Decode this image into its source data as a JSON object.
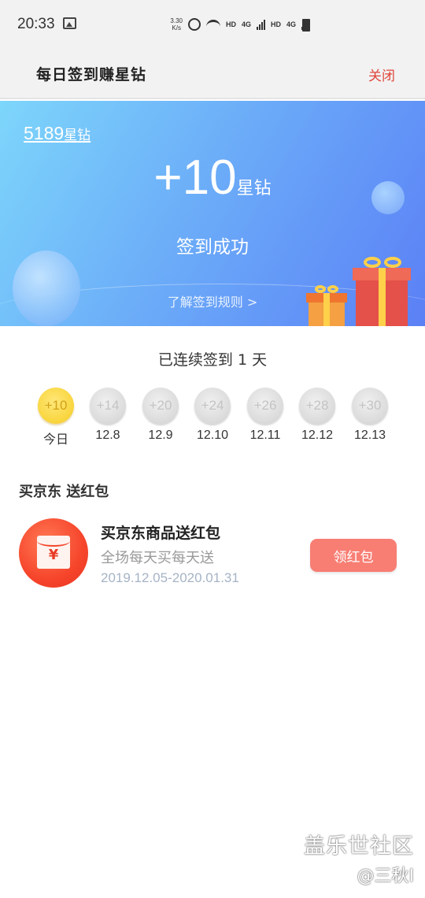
{
  "status_bar": {
    "time": "20:33",
    "net_speed_value": "3.30",
    "net_speed_unit": "K/s",
    "hd1": "HD",
    "net1": "4G",
    "hd2": "HD",
    "net2": "4G"
  },
  "header": {
    "title": "每日签到赚星钻",
    "close_label": "关闭"
  },
  "banner": {
    "balance_value": "5189",
    "balance_unit": "星钻",
    "gain_value": "+10",
    "gain_unit": "星钻",
    "status": "签到成功",
    "rules_link": "了解签到规则 >"
  },
  "streak": {
    "text": "已连续签到 1 天",
    "days": [
      {
        "reward": "+10",
        "label": "今日",
        "claimed": true
      },
      {
        "reward": "+14",
        "label": "12.8",
        "claimed": false
      },
      {
        "reward": "+20",
        "label": "12.9",
        "claimed": false
      },
      {
        "reward": "+24",
        "label": "12.10",
        "claimed": false
      },
      {
        "reward": "+26",
        "label": "12.11",
        "claimed": false
      },
      {
        "reward": "+28",
        "label": "12.12",
        "claimed": false
      },
      {
        "reward": "+30",
        "label": "12.13",
        "claimed": false
      }
    ]
  },
  "section": {
    "title": "买京东 送红包"
  },
  "promo": {
    "icon_symbol": "¥",
    "name": "买京东商品送红包",
    "description": "全场每天买每天送",
    "dates": "2019.12.05-2020.01.31",
    "button_label": "领红包"
  },
  "watermark": {
    "line1": "盖乐世社区",
    "line2": "@三秋I"
  }
}
